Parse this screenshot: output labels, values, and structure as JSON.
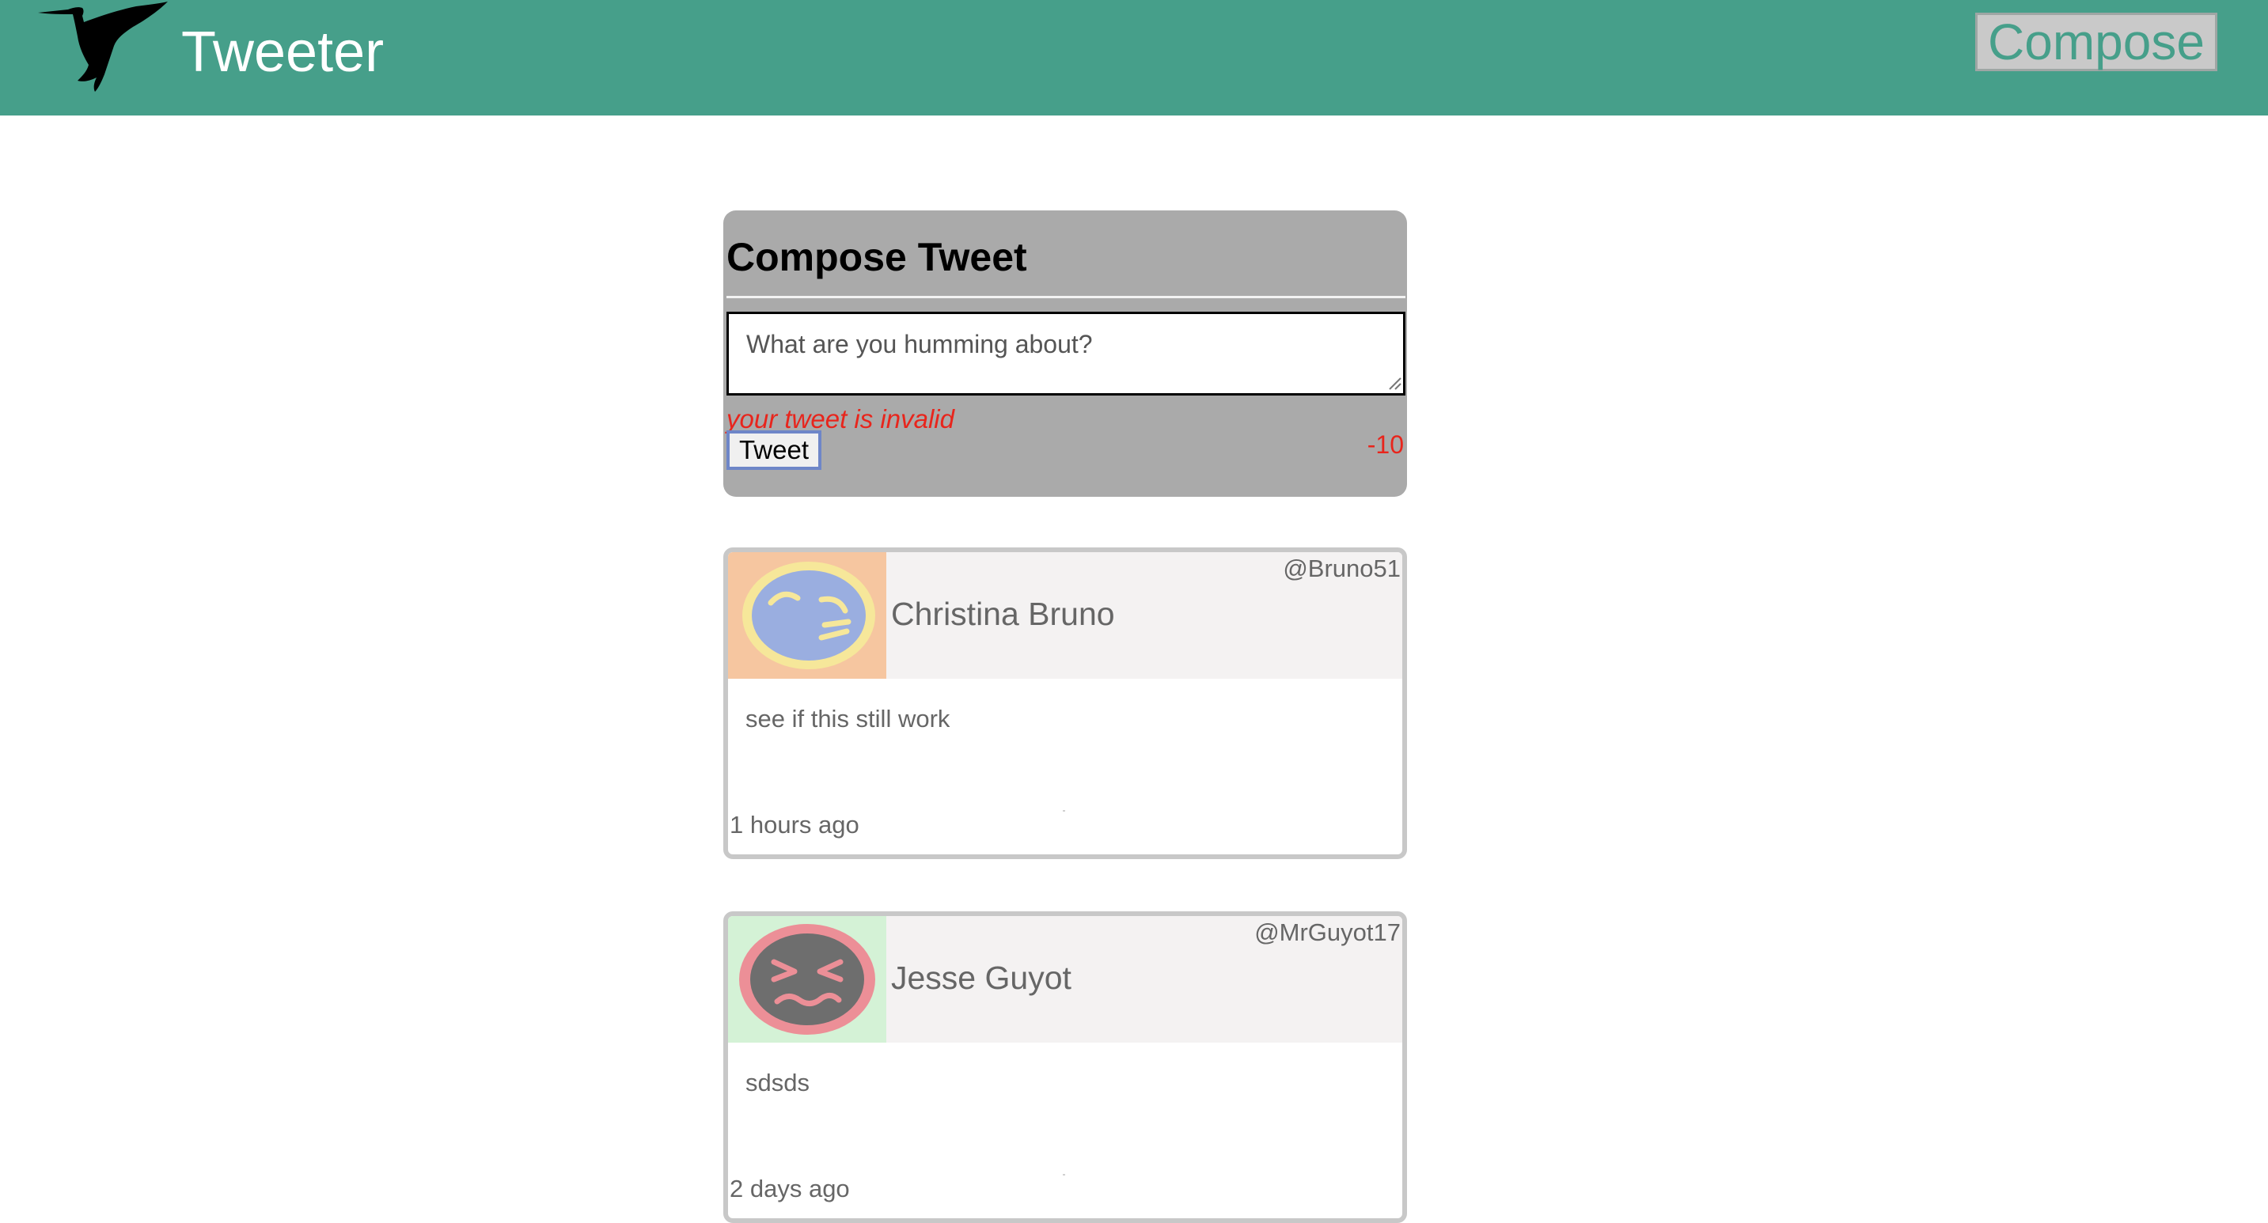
{
  "header": {
    "logo_icon": "hummingbird-icon",
    "app_name": "Tweeter",
    "compose_label": "Compose",
    "brand_color": "#469f8a"
  },
  "compose": {
    "title": "Compose Tweet",
    "placeholder": "What are you humming about?",
    "error_message": "your tweet is invalid",
    "tweet_button_label": "Tweet",
    "char_counter": "-10",
    "error_color": "#e8251c"
  },
  "tweets": [
    {
      "avatar_icon": "sleepy-face-avatar",
      "name": "Christina Bruno",
      "handle": "@Bruno51",
      "text": "see if this still work",
      "time": "1 hours ago"
    },
    {
      "avatar_icon": "squinting-face-avatar",
      "name": "Jesse Guyot",
      "handle": "@MrGuyot17",
      "text": "sdsds",
      "time": "2 days ago"
    }
  ]
}
